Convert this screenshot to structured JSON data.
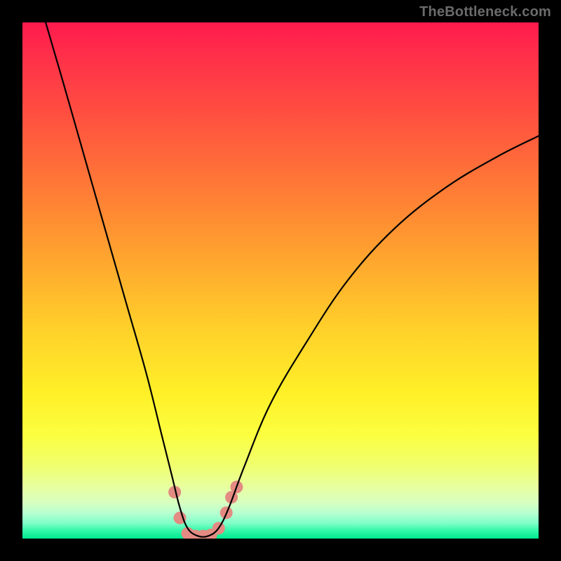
{
  "watermark": "TheBottleneck.com",
  "chart_data": {
    "type": "line",
    "title": "",
    "xlabel": "",
    "ylabel": "",
    "xlim": [
      0,
      100
    ],
    "ylim": [
      0,
      100
    ],
    "grid": false,
    "legend": false,
    "annotations": [],
    "curve": {
      "name": "bottleneck-curve",
      "color": "#000000",
      "points": [
        {
          "x": 4.5,
          "y": 100
        },
        {
          "x": 8,
          "y": 88
        },
        {
          "x": 12,
          "y": 74
        },
        {
          "x": 16,
          "y": 60
        },
        {
          "x": 20,
          "y": 46
        },
        {
          "x": 24,
          "y": 32
        },
        {
          "x": 27,
          "y": 20
        },
        {
          "x": 29,
          "y": 12
        },
        {
          "x": 30.5,
          "y": 6
        },
        {
          "x": 32,
          "y": 2
        },
        {
          "x": 34,
          "y": 0.5
        },
        {
          "x": 36,
          "y": 0.5
        },
        {
          "x": 38,
          "y": 2
        },
        {
          "x": 40,
          "y": 6
        },
        {
          "x": 43,
          "y": 14
        },
        {
          "x": 48,
          "y": 26
        },
        {
          "x": 55,
          "y": 38
        },
        {
          "x": 63,
          "y": 50
        },
        {
          "x": 72,
          "y": 60
        },
        {
          "x": 82,
          "y": 68
        },
        {
          "x": 92,
          "y": 74
        },
        {
          "x": 100,
          "y": 78
        }
      ]
    },
    "markers": {
      "name": "highlight-dots",
      "color": "#e38b82",
      "radius_px": 9,
      "points": [
        {
          "x": 29.5,
          "y": 9
        },
        {
          "x": 30.5,
          "y": 4
        },
        {
          "x": 32,
          "y": 1
        },
        {
          "x": 33.5,
          "y": 0.5
        },
        {
          "x": 35,
          "y": 0.5
        },
        {
          "x": 36.5,
          "y": 0.7
        },
        {
          "x": 38,
          "y": 2
        },
        {
          "x": 39.5,
          "y": 5
        },
        {
          "x": 40.5,
          "y": 8
        },
        {
          "x": 41.5,
          "y": 10
        }
      ]
    }
  }
}
